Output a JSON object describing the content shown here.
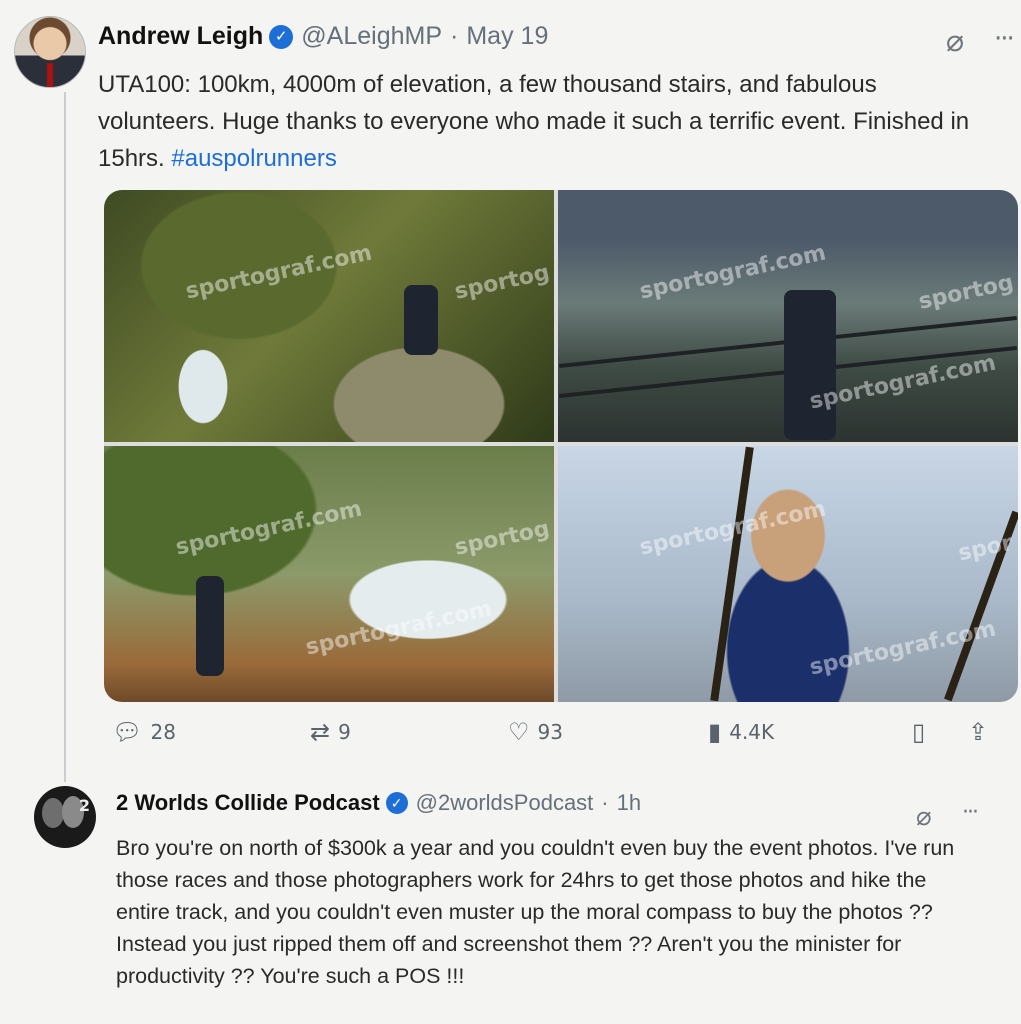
{
  "tweet": {
    "author_name": "Andrew Leigh",
    "handle": "@ALeighMP",
    "separator": "·",
    "date": "May 19",
    "text_main": "UTA100: 100km, 4000m of elevation, a few thousand stairs, and fabulous volunteers. Huge thanks to everyone who made it such a terrific event. Finished in 15hrs.",
    "hashtag": "#auspolrunners",
    "photos": [
      {
        "watermark_a": "sportograf.com",
        "watermark_b": "sportog"
      },
      {
        "watermark_a": "sportograf.com",
        "watermark_b": "sportog",
        "watermark_c": "sportograf.com"
      },
      {
        "watermark_a": "sportograf.com",
        "watermark_b": "sportog",
        "watermark_c": "sportograf.com"
      },
      {
        "watermark_a": "sportograf.com",
        "watermark_b": "spor",
        "watermark_c": "sportograf.com"
      }
    ],
    "actions": {
      "replies": "28",
      "retweets": "9",
      "likes": "93",
      "views": "4.4K"
    }
  },
  "reply": {
    "author_name": "2 Worlds Collide Podcast",
    "handle": "@2worldsPodcast",
    "separator": "·",
    "time": "1h",
    "avatar_text": "2",
    "text": "Bro you're on north of $300k a year and you couldn't even buy the event photos. I've run those races and those photographers work for 24hrs to get those photos and hike the entire track, and you couldn't even muster up the moral compass to buy the photos ?? Instead you just ripped them off and screenshot them ?? Aren't you the minister for productivity ?? You're such a POS !!!"
  },
  "icons": {
    "verified": "verified-badge-icon",
    "grok": "grok-icon",
    "more": "more-options-icon",
    "reply": "reply-icon",
    "retweet": "retweet-icon",
    "like": "heart-icon",
    "views": "views-icon",
    "bookmark": "bookmark-icon",
    "share": "share-icon"
  },
  "colors": {
    "accent": "#1d6fd6",
    "muted_text": "#66707a",
    "background": "#f4f4f2"
  }
}
